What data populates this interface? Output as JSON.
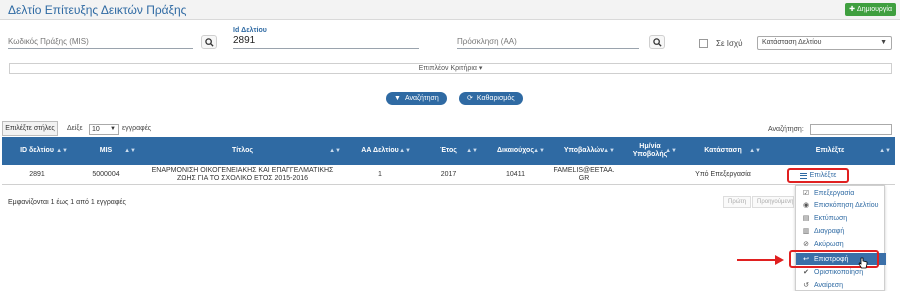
{
  "header": {
    "title": "Δελτίο Επίτευξης Δεικτών Πράξης",
    "create_label": "Δημιουργία",
    "create_icon": "plus-icon"
  },
  "filters": {
    "mis_placeholder": "Κωδικός Πράξης (MIS)",
    "id_label": "Id Δελτίου",
    "id_value": "2891",
    "call_placeholder": "Πρόσκληση (ΑΑ)",
    "in_force_label": "Σε Ισχύ",
    "status_select": "Κατάσταση Δελτίου",
    "criteria_label": "Επιπλέον Κριτήρια ▾"
  },
  "actions": {
    "search_label": "Αναζήτηση",
    "clear_label": "Καθαρισμός"
  },
  "table_controls": {
    "columns_label": "Επιλέξτε στήλες",
    "show_label": "Δείξε",
    "page_size": "10",
    "records_label": "εγγραφές",
    "search_label": "Αναζήτηση:"
  },
  "table": {
    "headers": [
      "ID δελτίου",
      "MIS",
      "Τίτλος",
      "ΑΑ Δελτίου",
      "Έτος",
      "Δικαιούχος",
      "Υποβαλλών",
      "Ημ/νία Υποβολής",
      "Κατάσταση",
      "Επιλέξτε"
    ],
    "rows": [
      [
        "2891",
        "5000004",
        "ΕΝΑΡΜΟΝΙΣΗ ΟΙΚΟΓΕΝΕΙΑΚΗΣ ΚΑΙ ΕΠΑΓΓΕΛΜΑΤΙΚΗΣ ΖΩΗΣ ΓΙΑ ΤΟ ΣΧΟΛΙΚΟ ΕΤΟΣ 2015-2016",
        "1",
        "2017",
        "10411",
        "FAMELIS@EETAA.GR",
        "",
        "Υπό Επεξεργασία",
        "Επιλέξτε"
      ]
    ]
  },
  "footer": {
    "info": "Εμφανίζονται 1 έως 1 από 1 εγγραφές",
    "first_label": "Πρώτη",
    "prev_label": "Προηγούμενη"
  },
  "menu": {
    "items": [
      {
        "label": "Επεξεργασία",
        "icon": "edit-check-icon"
      },
      {
        "label": "Επισκόπηση Δελτίου",
        "icon": "eye-icon"
      },
      {
        "label": "Εκτύπωση",
        "icon": "print-icon"
      },
      {
        "label": "Διαγραφή",
        "icon": "trash-icon"
      },
      {
        "label": "Ακύρωση",
        "icon": "ban-icon"
      },
      {
        "label": "Επιστροφή",
        "icon": "return-icon"
      },
      {
        "label": "Οριστικοποίηση",
        "icon": "check-circle-icon"
      },
      {
        "label": "Αναίρεση",
        "icon": "undo-icon"
      }
    ]
  },
  "colors": {
    "primary": "#2f6aa3",
    "success": "#3f9f3f",
    "highlight": "#e02020"
  }
}
